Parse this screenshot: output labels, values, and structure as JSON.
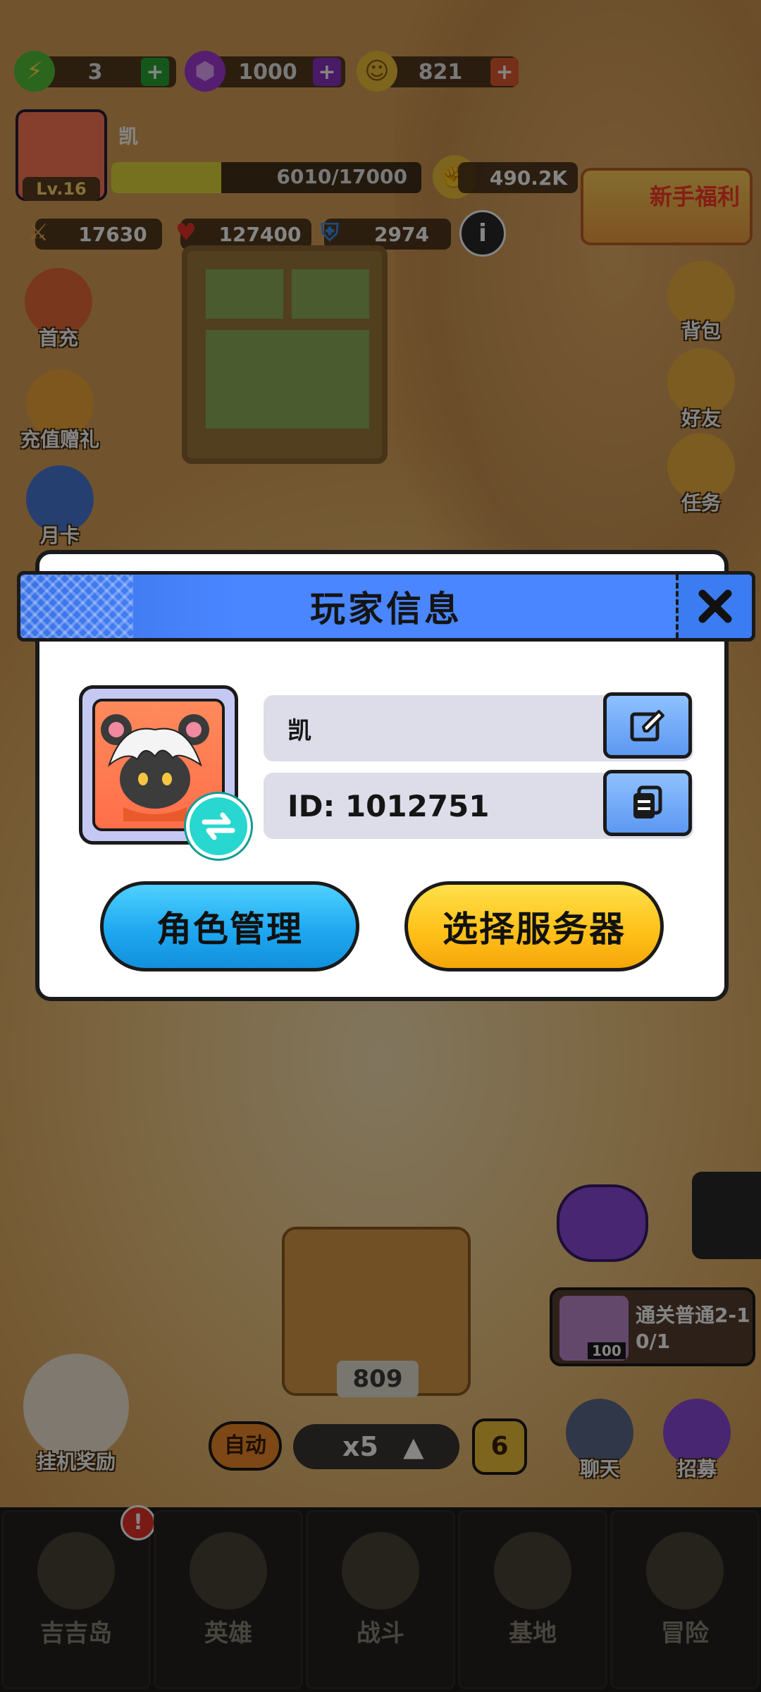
{
  "resources": {
    "energy": "3",
    "gems": "1000",
    "coins": "821"
  },
  "player": {
    "name": "凯",
    "level": "Lv.16",
    "exp": "6010/17000",
    "exp_fraction": 0.354,
    "power": "490.2K",
    "attack": "17630",
    "hp": "127400",
    "defense": "2974"
  },
  "banner": {
    "newbie_benefits": "新手福利"
  },
  "left_menu": {
    "first_charge": "首充",
    "recharge_gift": "充值赠礼",
    "monthly_card": "月卡"
  },
  "right_menu": {
    "bag": "背包",
    "friends": "好友",
    "tasks": "任务"
  },
  "modal": {
    "title": "玩家信息",
    "name_value": "凯",
    "id_value": "ID: 1012751",
    "role_manage": "角色管理",
    "select_server": "选择服务器"
  },
  "scene": {
    "chest_count": "809",
    "quest_title": "通关普通2-1",
    "quest_progress": "0/1",
    "quest_reward": "100",
    "auto_label": "自动",
    "speed_label": "x5",
    "stage_number": "6",
    "idle_reward": "挂机奖励",
    "chat": "聊天",
    "recruit": "招募"
  },
  "bottom_nav": {
    "island": "吉吉岛",
    "heroes": "英雄",
    "battle": "战斗",
    "base": "基地",
    "adventure": "冒险"
  },
  "colors": {
    "header_blue": "#4a86ff",
    "role_btn_blue": "#1ea8f0",
    "server_btn_yellow": "#ffc21a",
    "swap_teal": "#28d7cf"
  }
}
